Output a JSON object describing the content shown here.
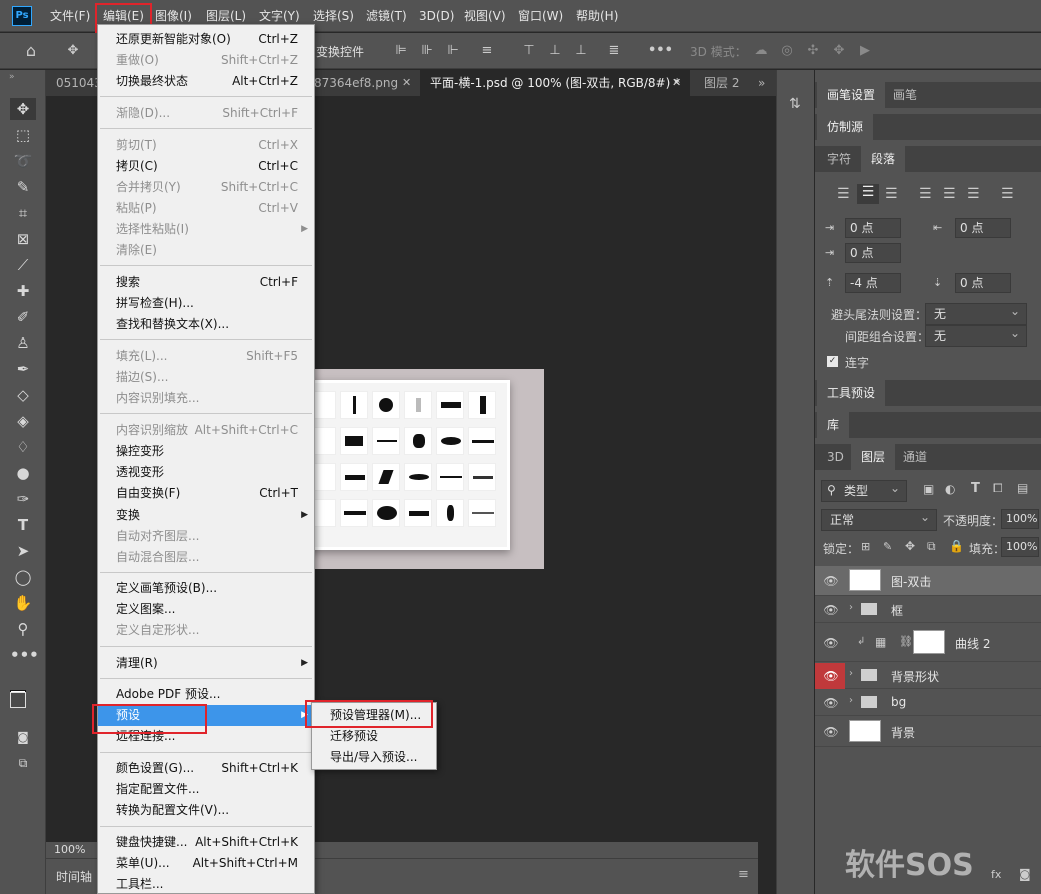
{
  "menubar": {
    "logo": "Ps",
    "items": [
      "文件(F)",
      "编辑(E)",
      "图像(I)",
      "图层(L)",
      "文字(Y)",
      "选择(S)",
      "滤镜(T)",
      "3D(D)",
      "视图(V)",
      "窗口(W)",
      "帮助(H)"
    ]
  },
  "options": {
    "transform_controls": "变换控件",
    "mode_3d": "3D 模式："
  },
  "tabs": {
    "tab1": "051043",
    "tab2": "87364ef8.png",
    "tab3": "平面-横-1.psd @ 100% (图-双击, RGB/8#) *",
    "tab4": "图层 2",
    "more": "»"
  },
  "status": {
    "zoom": "100%",
    "timeline": "时间轴"
  },
  "edit_menu": {
    "items": [
      {
        "label": "还原更新智能对象(O)",
        "key": "Ctrl+Z",
        "disabled": false
      },
      {
        "label": "重做(O)",
        "key": "Shift+Ctrl+Z",
        "disabled": true
      },
      {
        "label": "切换最终状态",
        "key": "Alt+Ctrl+Z",
        "disabled": false
      },
      {
        "label": "渐隐(D)...",
        "key": "Shift+Ctrl+F",
        "disabled": true
      },
      {
        "label": "剪切(T)",
        "key": "Ctrl+X",
        "disabled": true
      },
      {
        "label": "拷贝(C)",
        "key": "Ctrl+C",
        "disabled": false
      },
      {
        "label": "合并拷贝(Y)",
        "key": "Shift+Ctrl+C",
        "disabled": true
      },
      {
        "label": "粘贴(P)",
        "key": "Ctrl+V",
        "disabled": true
      },
      {
        "label": "选择性粘贴(I)",
        "key": "",
        "disabled": true
      },
      {
        "label": "清除(E)",
        "key": "",
        "disabled": true
      },
      {
        "label": "搜索",
        "key": "Ctrl+F",
        "disabled": false
      },
      {
        "label": "拼写检查(H)...",
        "key": "",
        "disabled": false
      },
      {
        "label": "查找和替换文本(X)...",
        "key": "",
        "disabled": false
      },
      {
        "label": "填充(L)...",
        "key": "Shift+F5",
        "disabled": true
      },
      {
        "label": "描边(S)...",
        "key": "",
        "disabled": true
      },
      {
        "label": "内容识别填充...",
        "key": "",
        "disabled": true
      },
      {
        "label": "内容识别缩放",
        "key": "Alt+Shift+Ctrl+C",
        "disabled": true
      },
      {
        "label": "操控变形",
        "key": "",
        "disabled": false
      },
      {
        "label": "透视变形",
        "key": "",
        "disabled": false
      },
      {
        "label": "自由变换(F)",
        "key": "Ctrl+T",
        "disabled": false
      },
      {
        "label": "变换",
        "key": "",
        "disabled": false
      },
      {
        "label": "自动对齐图层...",
        "key": "",
        "disabled": true
      },
      {
        "label": "自动混合图层...",
        "key": "",
        "disabled": true
      },
      {
        "label": "定义画笔预设(B)...",
        "key": "",
        "disabled": false
      },
      {
        "label": "定义图案...",
        "key": "",
        "disabled": false
      },
      {
        "label": "定义自定形状...",
        "key": "",
        "disabled": true
      },
      {
        "label": "清理(R)",
        "key": "",
        "disabled": false
      },
      {
        "label": "Adobe PDF 预设...",
        "key": "",
        "disabled": false
      },
      {
        "label": "预设",
        "key": "",
        "disabled": false
      },
      {
        "label": "远程连接...",
        "key": "",
        "disabled": false
      },
      {
        "label": "颜色设置(G)...",
        "key": "Shift+Ctrl+K",
        "disabled": false
      },
      {
        "label": "指定配置文件...",
        "key": "",
        "disabled": false
      },
      {
        "label": "转换为配置文件(V)...",
        "key": "",
        "disabled": false
      },
      {
        "label": "键盘快捷键...",
        "key": "Alt+Shift+Ctrl+K",
        "disabled": false
      },
      {
        "label": "菜单(U)...",
        "key": "Alt+Shift+Ctrl+M",
        "disabled": false
      },
      {
        "label": "工具栏...",
        "key": "",
        "disabled": false
      }
    ]
  },
  "preset_submenu": {
    "items": [
      "预设管理器(M)...",
      "迁移预设",
      "导出/导入预设..."
    ]
  },
  "panels": {
    "tabs_row1": [
      "画笔设置",
      "画笔"
    ],
    "tabs_row2": [
      "仿制源"
    ],
    "tabs_row3": [
      "字符",
      "段落"
    ],
    "paragraph": {
      "indent_left": "0 点",
      "indent_right": "0 点",
      "indent_first": "0 点",
      "space_before": "-4 点",
      "space_after": "0 点",
      "kinsoku_label": "避头尾法则设置：",
      "kinsoku_value": "无",
      "mojikumi_label": "间距组合设置：",
      "mojikumi_value": "无",
      "hyphenate_label": "连字"
    },
    "tool_presets": "工具预设",
    "library": "库",
    "layer_tabs": [
      "3D",
      "图层",
      "通道"
    ],
    "layers": {
      "filter": "类型",
      "blend_mode": "正常",
      "opacity_label": "不透明度：",
      "opacity": "100%",
      "lock_label": "锁定：",
      "fill_label": "填充：",
      "fill": "100%",
      "list": [
        {
          "name": "图-双击"
        },
        {
          "name": "框"
        },
        {
          "name": "曲线 2"
        },
        {
          "name": "背景形状"
        },
        {
          "name": "bg"
        },
        {
          "name": "背景"
        }
      ]
    }
  },
  "watermark": "软件SOS"
}
